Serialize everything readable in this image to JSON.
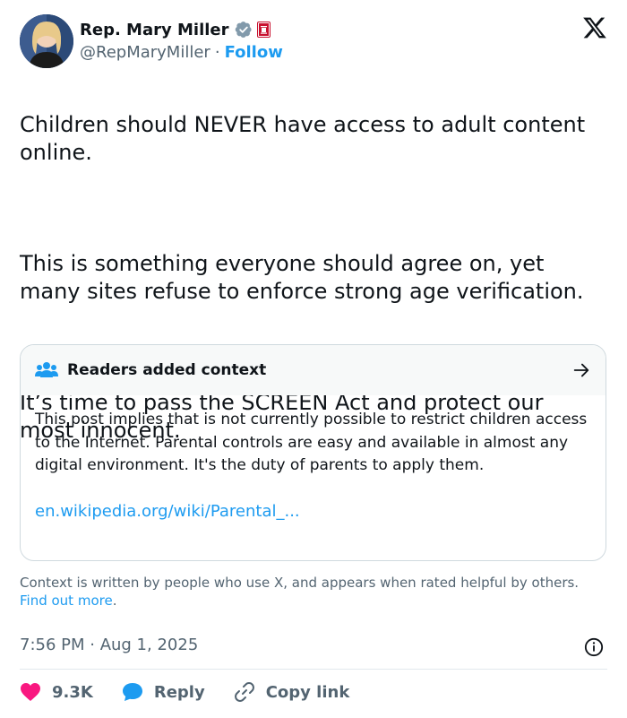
{
  "author": {
    "name": "Rep. Mary Miller",
    "handle": "@RepMaryMiller",
    "separator": "·",
    "follow_label": "Follow"
  },
  "tweet": {
    "paragraphs": [
      "Children should NEVER have access to adult content online.",
      "This is something everyone should agree on, yet many sites refuse to enforce strong age verification.",
      "It’s time to pass the SCREEN Act and protect our most innocent."
    ]
  },
  "context": {
    "title": "Readers added context",
    "body": "This post implies that is not currently possible to restrict children access to the Internet. Parental controls are easy and available in almost any digital environment. It's the duty of parents to apply them.",
    "link": "en.wikipedia.org/wiki/Parental_..."
  },
  "note": {
    "text": "Context is written by people who use X, and appears when rated helpful by others.",
    "more": "Find out more",
    "suffix": "."
  },
  "timestamp": "7:56 PM · Aug 1, 2025",
  "actions": {
    "likes": "9.3K",
    "reply_label": "Reply",
    "copy_label": "Copy link"
  },
  "colors": {
    "accent": "#1d9bf0",
    "like": "#f91880",
    "muted": "#536471",
    "verified": "#829aab"
  },
  "icons": [
    "verified-badge-icon",
    "congress-flag-icon",
    "x-logo-icon",
    "people-icon",
    "arrow-right-icon",
    "info-icon",
    "heart-icon",
    "reply-bubble-icon",
    "link-icon"
  ]
}
